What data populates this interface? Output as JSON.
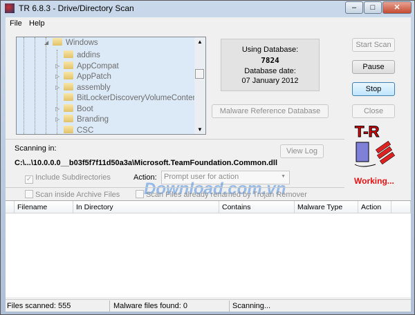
{
  "window": {
    "title": "TR 6.8.3  -  Drive/Directory Scan",
    "minimize": "–",
    "maximize": "□",
    "close": "✕"
  },
  "menu": [
    "File",
    "Help"
  ],
  "tree": {
    "root": "Windows",
    "items": [
      {
        "label": "addins",
        "expandable": false
      },
      {
        "label": "AppCompat",
        "expandable": true
      },
      {
        "label": "AppPatch",
        "expandable": true
      },
      {
        "label": "assembly",
        "expandable": true
      },
      {
        "label": "BitLockerDiscoveryVolumeContents",
        "expandable": false
      },
      {
        "label": "Boot",
        "expandable": true
      },
      {
        "label": "Branding",
        "expandable": true
      },
      {
        "label": "CSC",
        "expandable": false
      }
    ]
  },
  "database": {
    "using_label": "Using Database:",
    "version": "7824",
    "date_label": "Database date:",
    "date": "07 January 2012"
  },
  "buttons": {
    "start_scan": "Start Scan",
    "pause": "Pause",
    "stop": "Stop",
    "close": "Close",
    "malware_db": "Malware Reference Database",
    "view_log": "View Log"
  },
  "scan": {
    "scanning_in_label": "Scanning in:",
    "path": "C:\\...\\10.0.0.0__b03f5f7f11d50a3a\\Microsoft.TeamFoundation.Common.dll",
    "status": "Working..."
  },
  "options": {
    "include_subdirs": "Include Subdirectories",
    "include_subdirs_checked": true,
    "action_label": "Action:",
    "action_value": "Prompt user for action",
    "scan_archive": "Scan inside Archive Files",
    "scan_renamed": "Scan Files already renamed by Trojan Remover"
  },
  "table": {
    "columns": [
      "Filename",
      "In Directory",
      "Contains",
      "Malware Type",
      "Action"
    ],
    "rows": []
  },
  "statusbar": {
    "files_scanned": "Files scanned: 555",
    "malware_found": "Malware files found: 0",
    "state": "Scanning..."
  },
  "logo": "T-R",
  "watermark": "Download.com.vn",
  "colors": {
    "working": "#e81010",
    "tree_bg": "#dce9f7"
  }
}
